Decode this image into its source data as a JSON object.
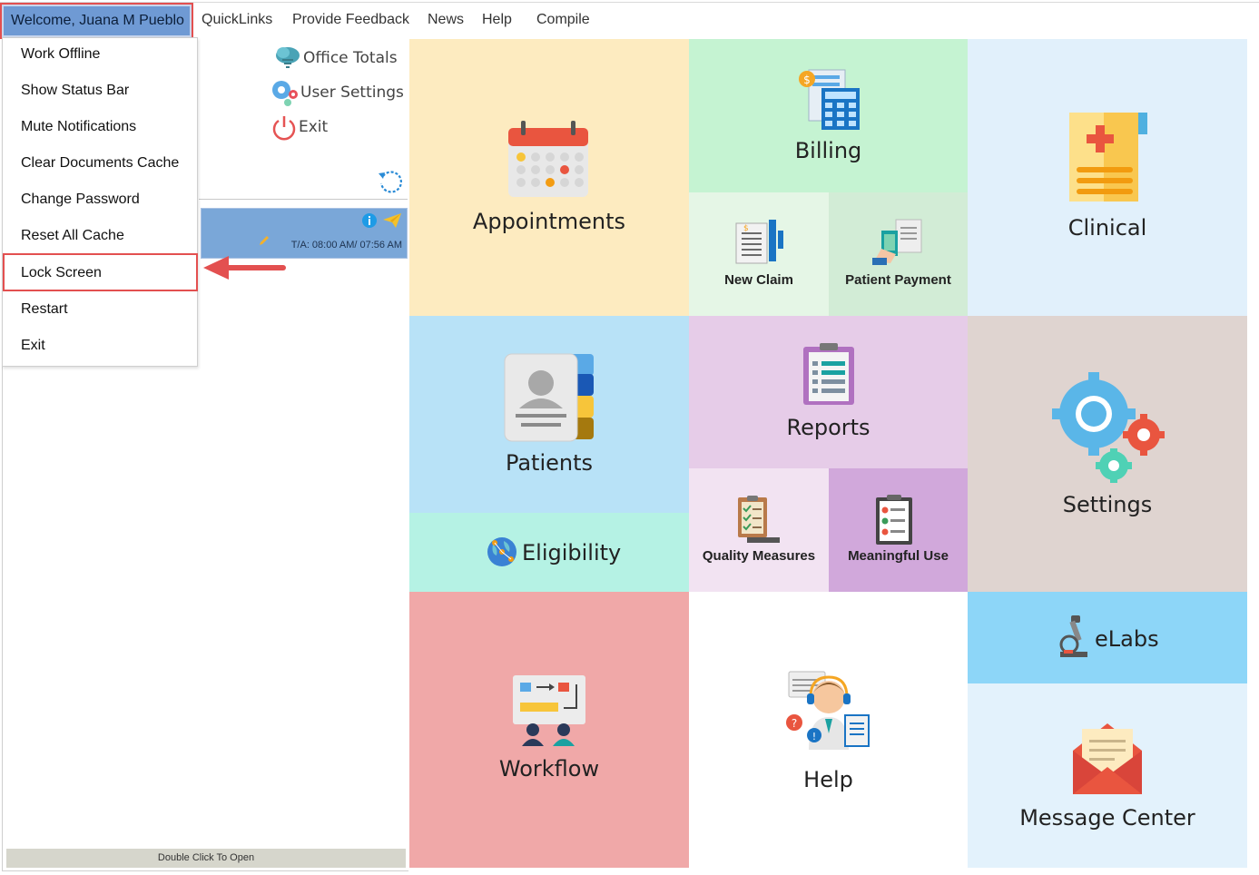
{
  "menubar": {
    "welcome": "Welcome, Juana M Pueblo",
    "quicklinks": "QuickLinks",
    "feedback": "Provide Feedback",
    "news": "News",
    "help": "Help",
    "compile": "Compile"
  },
  "dropdown": {
    "items": [
      "Work Offline",
      "Show Status Bar",
      "Mute Notifications",
      "Clear Documents Cache",
      "Change Password",
      "Reset All Cache",
      "Lock Screen",
      "Restart",
      "Exit"
    ],
    "highlighted": "Lock Screen"
  },
  "leftpanel": {
    "office_totals": "Office Totals",
    "user_settings": "User Settings",
    "exit": "Exit",
    "card_time": "T/A: 08:00 AM/ 07:56 AM",
    "status": "Double Click To Open"
  },
  "tiles": {
    "appointments": "Appointments",
    "billing": "Billing",
    "new_claim": "New Claim",
    "patient_payment": "Patient Payment",
    "clinical": "Clinical",
    "patients": "Patients",
    "eligibility": "Eligibility",
    "reports": "Reports",
    "quality_measures": "Quality Measures",
    "meaningful_use": "Meaningful Use",
    "settings": "Settings",
    "workflow": "Workflow",
    "help": "Help",
    "elabs": "eLabs",
    "message_center": "Message Center"
  },
  "colors": {
    "appointments": "#fdebc0",
    "billing": "#c5f3d2",
    "new_claim": "#e5f6e6",
    "patient_payment": "#d2ecd6",
    "clinical": "#e1f0fb",
    "patients": "#b8e2f7",
    "eligibility": "#b5f2e4",
    "reports": "#e6cce8",
    "quality_measures": "#f2e3f2",
    "meaningful_use": "#d1a8db",
    "settings": "#dfd4d0",
    "workflow": "#f0a8a8",
    "help": "#ffffff",
    "elabs": "#8dd6f8",
    "message_center": "#e3f2fc",
    "highlight": "#e35050"
  }
}
